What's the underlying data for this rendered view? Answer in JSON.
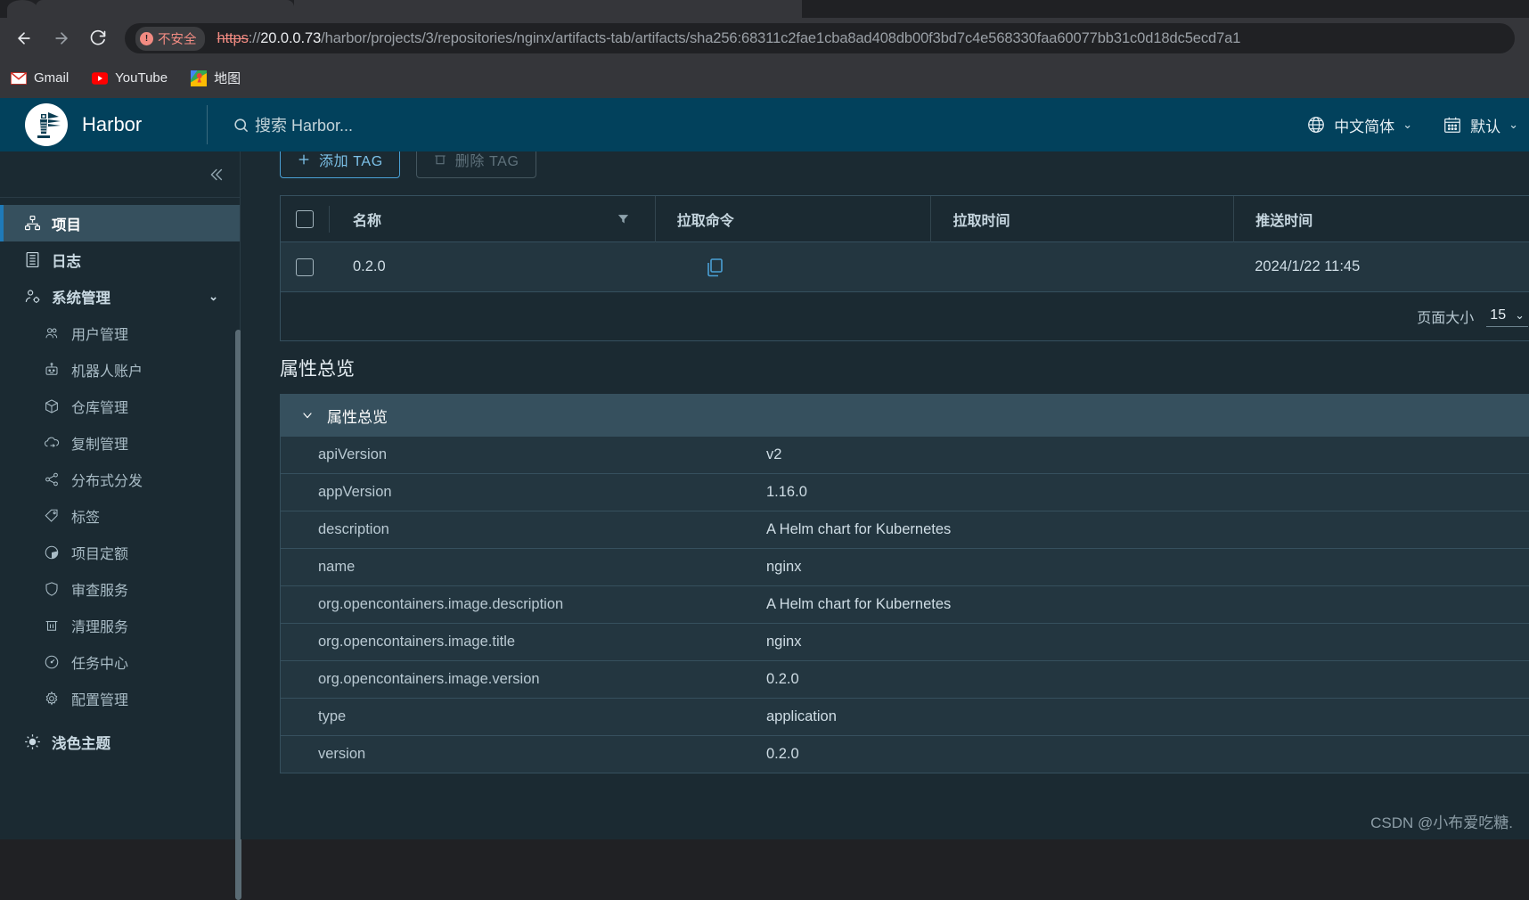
{
  "browser": {
    "security_label": "不安全",
    "url": {
      "scheme": "https",
      "separator": "://",
      "host": "20.0.0.73",
      "path": "/harbor/projects/3/repositories/nginx/artifacts-tab/artifacts/sha256:68311c2fae1cba8ad408db00f3bd7c4e568330faa60077bb31c0d18dc5ecd7a1"
    },
    "bookmarks": [
      {
        "label": "Gmail",
        "icon": "gmail-icon"
      },
      {
        "label": "YouTube",
        "icon": "youtube-icon"
      },
      {
        "label": "地图",
        "icon": "maps-icon"
      }
    ]
  },
  "header": {
    "brand": "Harbor",
    "search_placeholder": "搜索 Harbor...",
    "language": "中文简体",
    "theme_preset": "默认"
  },
  "sidebar": {
    "items": [
      {
        "label": "项目",
        "icon": "projects-icon",
        "level": "top",
        "active": true
      },
      {
        "label": "日志",
        "icon": "logs-icon",
        "level": "top",
        "active": false
      },
      {
        "label": "系统管理",
        "icon": "admin-icon",
        "level": "top",
        "active": false,
        "expandable": true
      },
      {
        "label": "用户管理",
        "icon": "users-icon",
        "level": "sub"
      },
      {
        "label": "机器人账户",
        "icon": "robot-icon",
        "level": "sub"
      },
      {
        "label": "仓库管理",
        "icon": "registry-icon",
        "level": "sub"
      },
      {
        "label": "复制管理",
        "icon": "replication-icon",
        "level": "sub"
      },
      {
        "label": "分布式分发",
        "icon": "distribution-icon",
        "level": "sub"
      },
      {
        "label": "标签",
        "icon": "label-icon",
        "level": "sub"
      },
      {
        "label": "项目定额",
        "icon": "quota-icon",
        "level": "sub"
      },
      {
        "label": "审查服务",
        "icon": "scanner-icon",
        "level": "sub"
      },
      {
        "label": "清理服务",
        "icon": "trash-icon",
        "level": "sub"
      },
      {
        "label": "任务中心",
        "icon": "jobs-icon",
        "level": "sub"
      },
      {
        "label": "配置管理",
        "icon": "config-icon",
        "level": "sub"
      }
    ],
    "theme_toggle": {
      "label": "浅色主题",
      "icon": "sun-icon"
    }
  },
  "main": {
    "toolbar": {
      "add_tag": "添加 TAG",
      "delete_tag": "删除 TAG"
    },
    "table": {
      "columns": [
        "名称",
        "拉取命令",
        "拉取时间",
        "推送时间"
      ],
      "rows": [
        {
          "name": "0.2.0",
          "pull_command": "",
          "pull_time": "",
          "push_time": "2024/1/22 11:45"
        }
      ],
      "page_size_label": "页面大小",
      "page_size_value": "15"
    },
    "attributes_section_title": "属性总览",
    "accordion_title": "属性总览",
    "attributes": [
      {
        "key": "apiVersion",
        "value": "v2"
      },
      {
        "key": "appVersion",
        "value": "1.16.0"
      },
      {
        "key": "description",
        "value": "A Helm chart for Kubernetes"
      },
      {
        "key": "name",
        "value": "nginx"
      },
      {
        "key": "org.opencontainers.image.description",
        "value": "A Helm chart for Kubernetes"
      },
      {
        "key": "org.opencontainers.image.title",
        "value": "nginx"
      },
      {
        "key": "org.opencontainers.image.version",
        "value": "0.2.0"
      },
      {
        "key": "type",
        "value": "application"
      },
      {
        "key": "version",
        "value": "0.2.0"
      }
    ]
  },
  "watermark": "CSDN @小布爱吃糖."
}
